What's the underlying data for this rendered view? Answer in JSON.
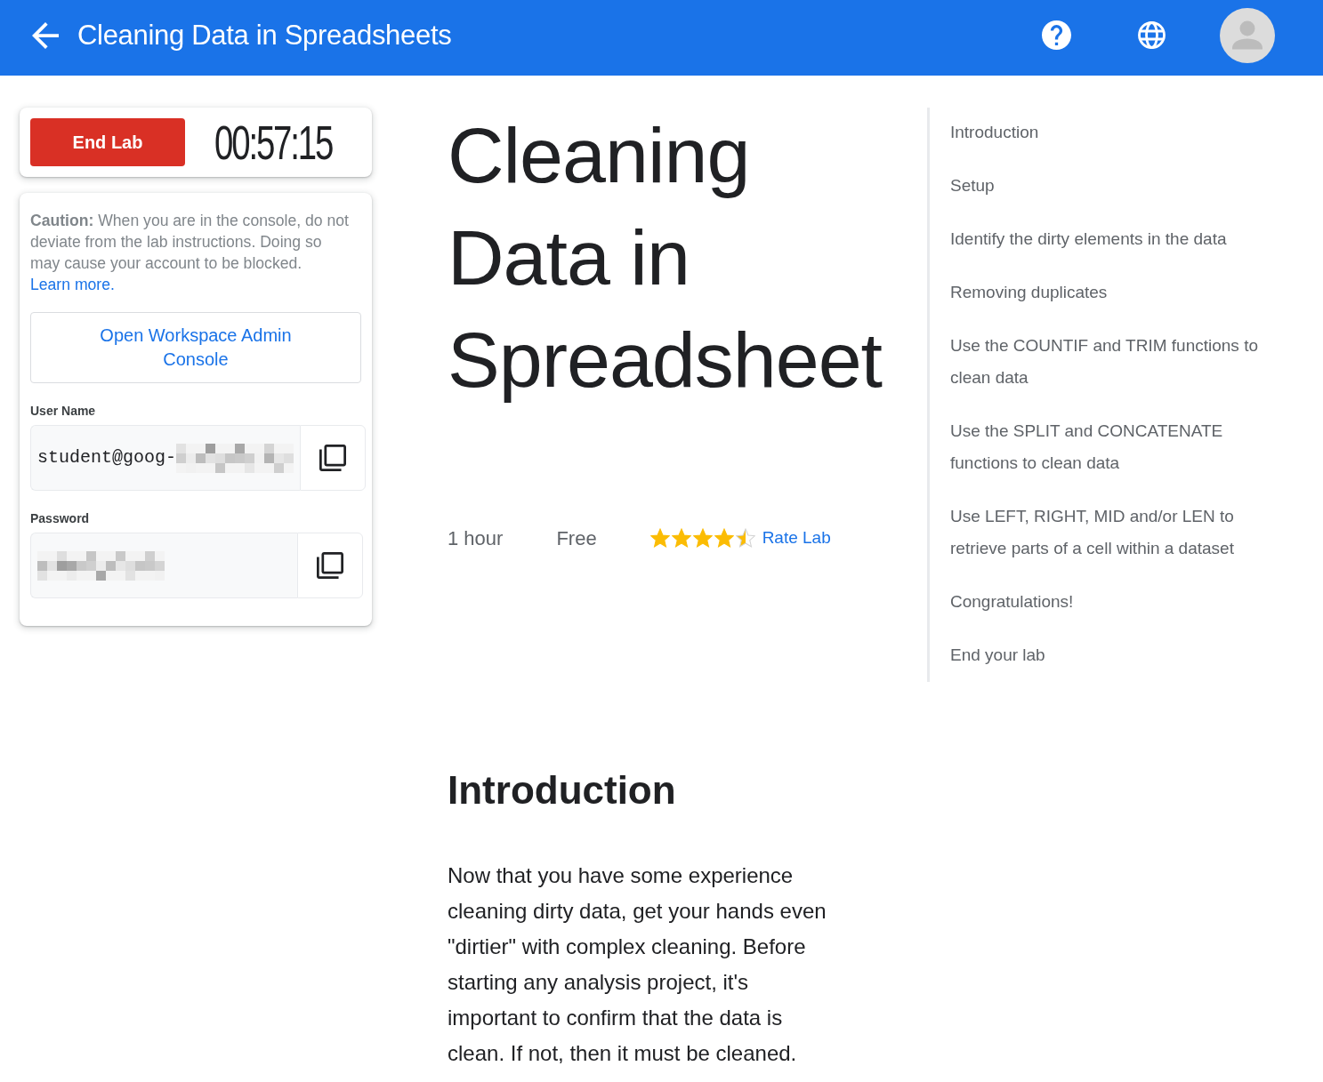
{
  "header": {
    "title": "Cleaning Data in Spreadsheets"
  },
  "lab_controls": {
    "end_button": "End Lab",
    "timer": "00:57:15"
  },
  "credentials": {
    "caution": "**Caution:** When you are in the console, do not deviate from the lab instructions. Doing so may cause your account to be blocked.",
    "learn_more": "Learn more.",
    "console_button": "Open Workspace Admin Console",
    "fields": [
      {
        "label": "User Name",
        "value": "student@goog-",
        "redacted": true
      },
      {
        "label": "Password",
        "redacted": true
      }
    ]
  },
  "lab": {
    "title": "Cleaning Data in Spreadsheet",
    "duration": "1 hour",
    "price": "Free",
    "stars": 4.5,
    "rate_link": "Rate Lab"
  },
  "section": {
    "heading": "Introduction",
    "text": "Now that you have some experience cleaning dirty data, get your hands even \"dirtier\" with complex cleaning. Before starting any analysis project, it's important to confirm that the data is clean. If not, then it must be cleaned."
  },
  "toc": [
    "Introduction",
    "Setup",
    "Identify the dirty elements in the data",
    "Removing duplicates",
    "Use the COUNTIF and TRIM functions to clean data",
    "Use the SPLIT and CONCATENATE functions to clean data",
    "Use LEFT, RIGHT, MID and/or LEN to retrieve parts of a cell within a dataset",
    "Congratulations!",
    "End your lab"
  ]
}
